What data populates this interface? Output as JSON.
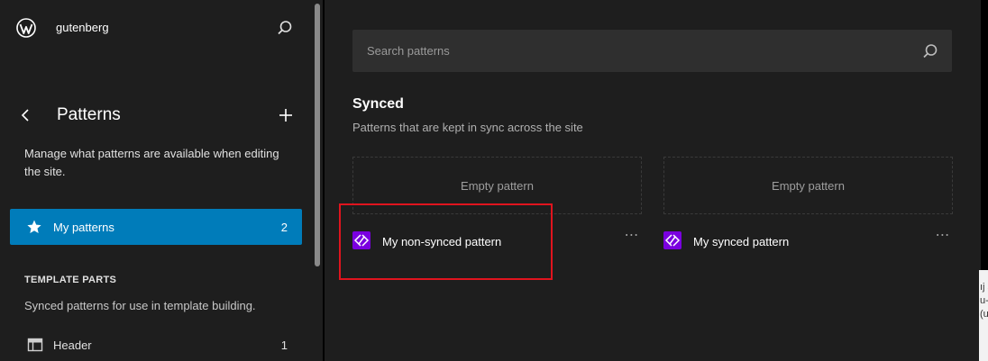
{
  "site": {
    "title": "gutenberg"
  },
  "sidebar": {
    "title": "Patterns",
    "description": "Manage what patterns are available when editing the site.",
    "active_item": {
      "label": "My patterns",
      "count": "2"
    },
    "template_parts": {
      "heading": "TEMPLATE PARTS",
      "description": "Synced patterns for use in template building.",
      "items": [
        {
          "label": "Header",
          "count": "1"
        }
      ]
    }
  },
  "main": {
    "search": {
      "placeholder": "Search patterns",
      "value": ""
    },
    "group": {
      "title": "Synced",
      "description": "Patterns that are kept in sync across the site"
    },
    "patterns": [
      {
        "preview": "Empty pattern",
        "name": "My non-synced pattern",
        "more": "⋯"
      },
      {
        "preview": "Empty pattern",
        "name": "My synced pattern",
        "more": "⋯"
      }
    ]
  },
  "edge_text": "ıj s\nu-\n(u",
  "colors": {
    "accent": "#007cba",
    "pattern_icon": "#7a00df",
    "highlight": "#e0141e",
    "sidebar_bg": "#1e1e1e"
  },
  "icons": [
    "wordpress-icon",
    "search-icon",
    "chevron-left-icon",
    "plus-icon",
    "star-icon",
    "header-icon",
    "symbol-icon",
    "more-icon"
  ]
}
